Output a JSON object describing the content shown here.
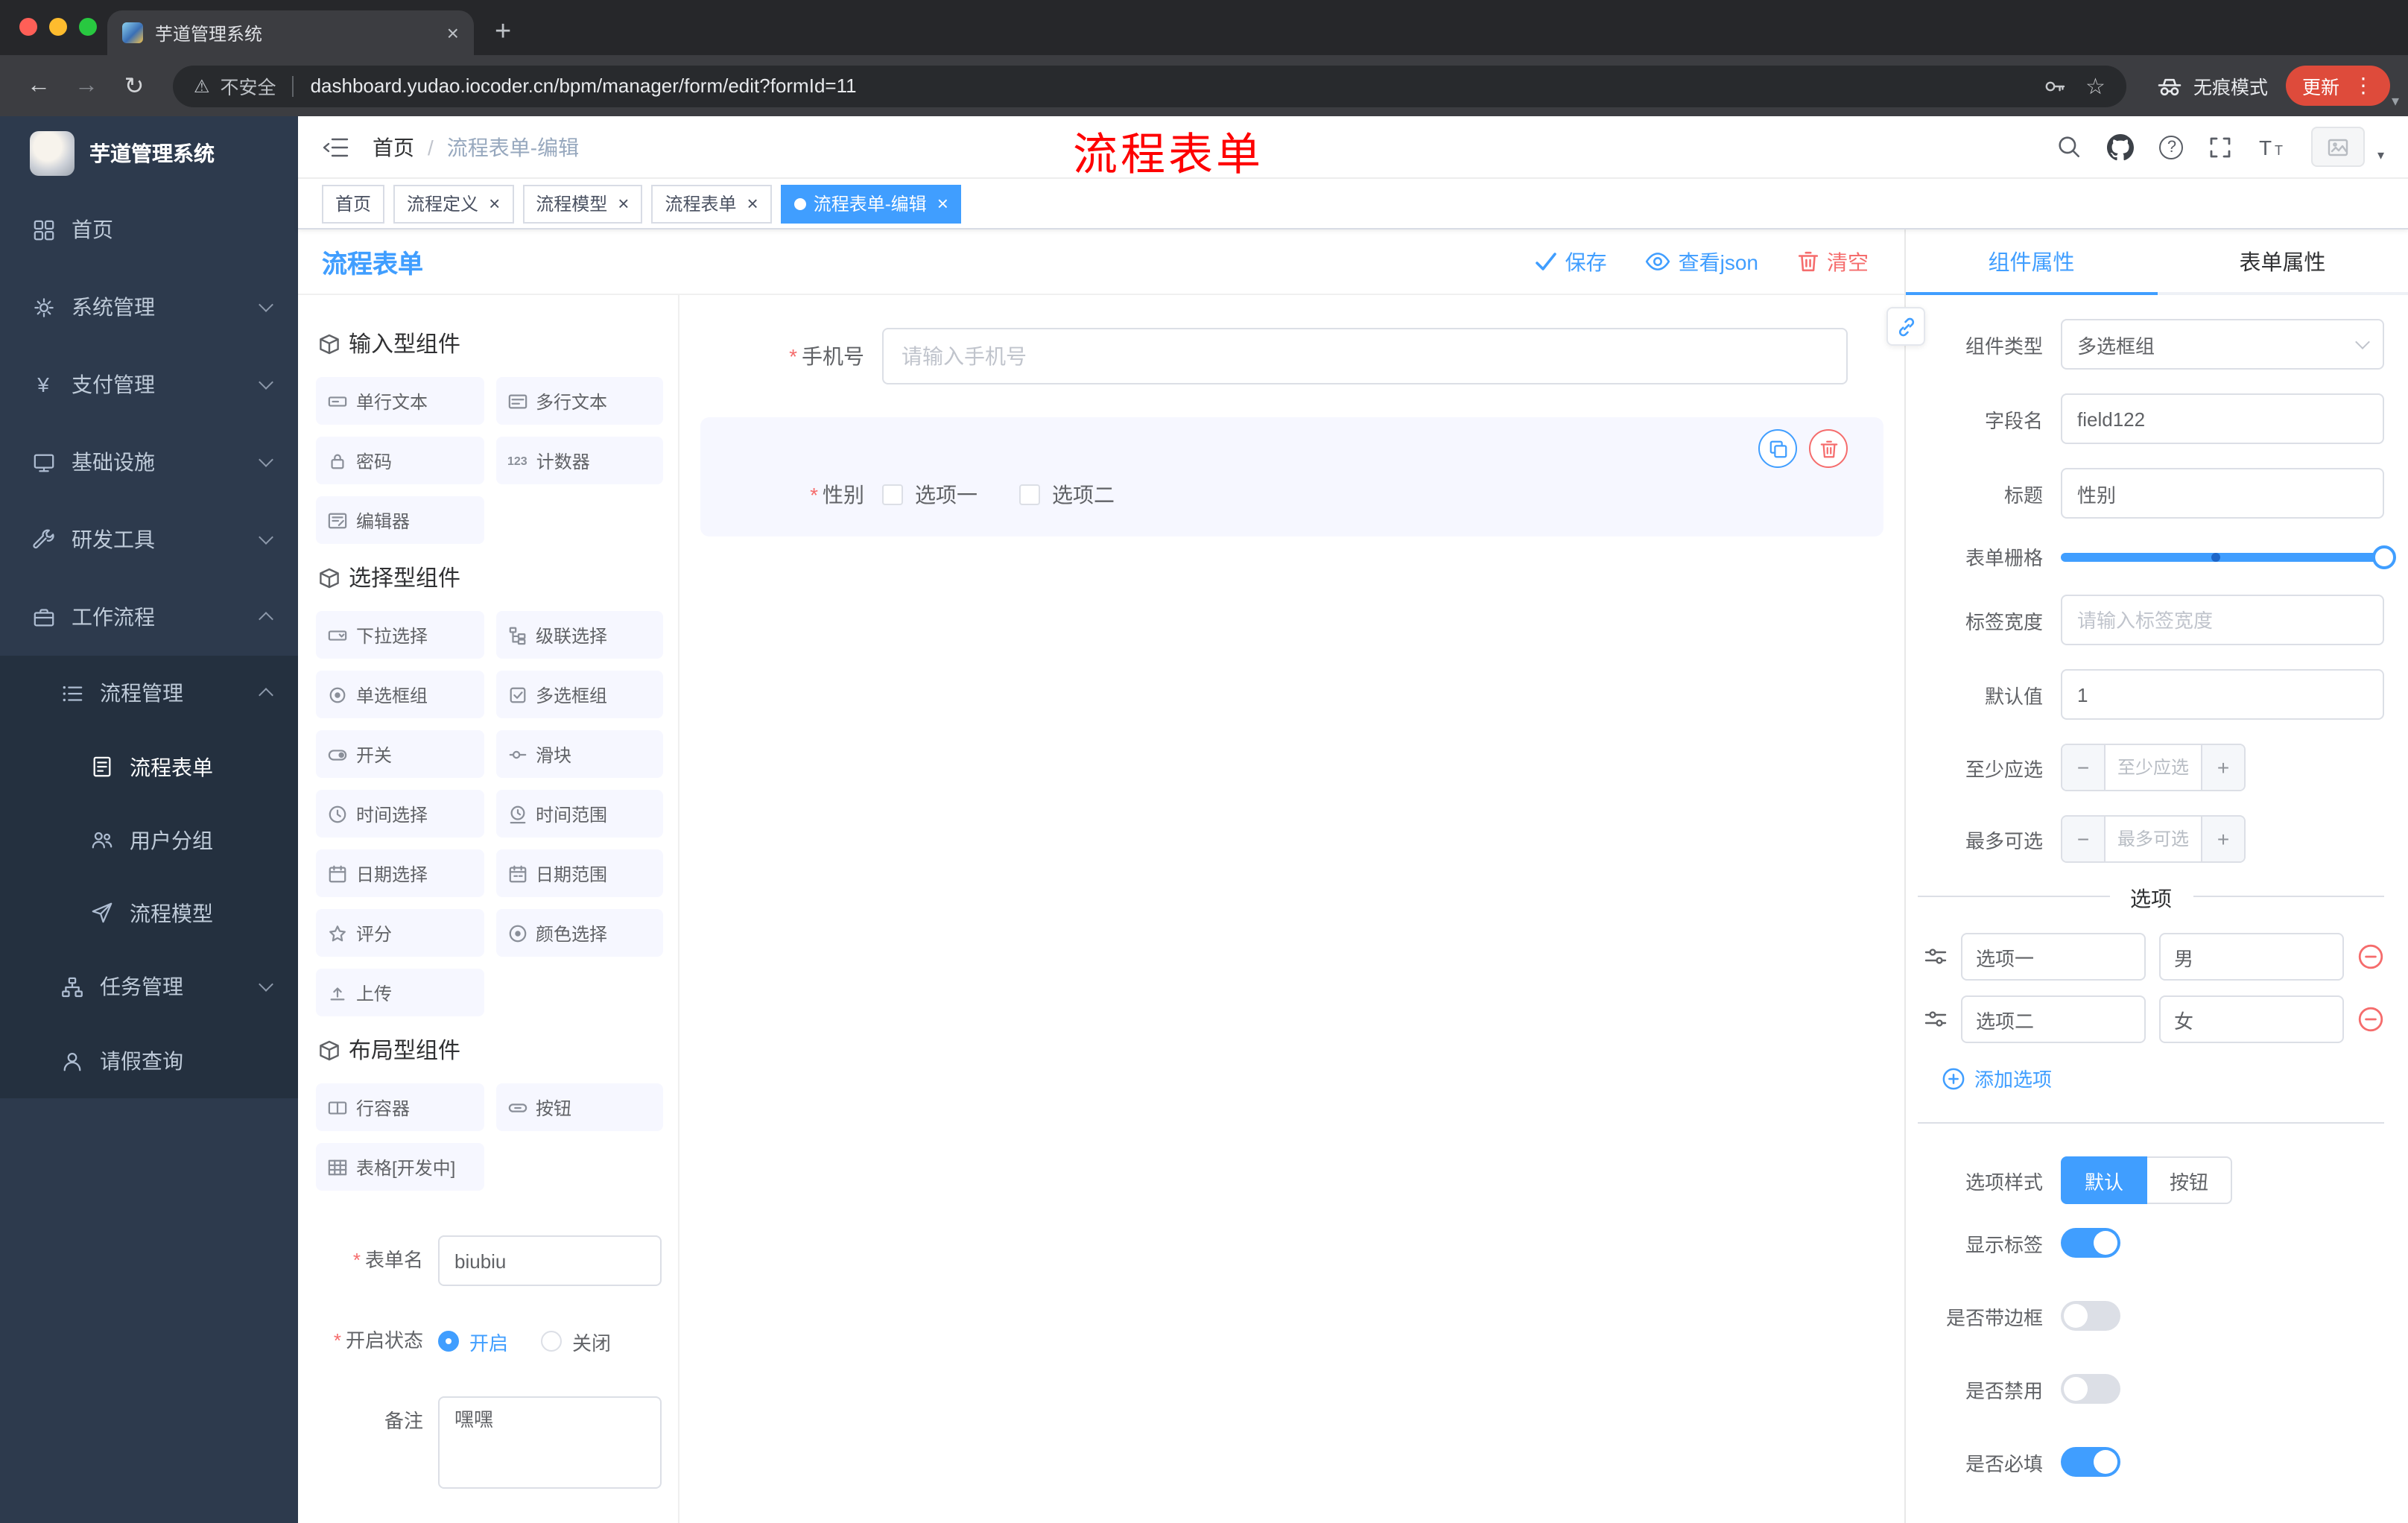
{
  "colors": {
    "accent": "#409eff",
    "danger": "#f56c6c",
    "sidebar_bg": "#2d3a4d",
    "annotation_red": "#fe0000",
    "update_pill": "#de4b3b",
    "palette_item_bg": "#f6f7ff"
  },
  "glyphs": {
    "close": "×",
    "plus": "+",
    "back": "←",
    "forward": "→",
    "reload": "↻",
    "star": "☆",
    "kebab": "⋮",
    "caret_down": "▾",
    "asterisk": "*",
    "minus": "−",
    "question": "?",
    "warning": "⚠",
    "yen": "¥",
    "counter": "123"
  },
  "browser": {
    "tab_title": "芋道管理系统",
    "security_label": "不安全",
    "url": "dashboard.yudao.iocoder.cn/bpm/manager/form/edit?formId=11",
    "incognito_label": "无痕模式",
    "update_label": "更新"
  },
  "sidebar": {
    "title": "芋道管理系统",
    "home": "首页",
    "system": "系统管理",
    "payment": "支付管理",
    "infra": "基础设施",
    "devtools": "研发工具",
    "workflow": "工作流程",
    "process_mgmt": "流程管理",
    "process_form": "流程表单",
    "user_group": "用户分组",
    "process_model": "流程模型",
    "task_mgmt": "任务管理",
    "leave_query": "请假查询"
  },
  "header": {
    "breadcrumb_home": "首页",
    "breadcrumb_sep": "/",
    "breadcrumb_current": "流程表单-编辑",
    "annotation": "流程表单"
  },
  "tags": {
    "items": [
      "首页",
      "流程定义",
      "流程模型",
      "流程表单",
      "流程表单-编辑"
    ]
  },
  "designer": {
    "title": "流程表单",
    "save": "保存",
    "view_json": "查看json",
    "clear": "清空"
  },
  "palette": {
    "input_section": "输入型组件",
    "select_section": "选择型组件",
    "layout_section": "布局型组件",
    "input_items": [
      "单行文本",
      "多行文本",
      "密码",
      "计数器",
      "编辑器"
    ],
    "select_items": [
      "下拉选择",
      "级联选择",
      "单选框组",
      "多选框组",
      "开关",
      "滑块",
      "时间选择",
      "时间范围",
      "日期选择",
      "日期范围",
      "评分",
      "颜色选择",
      "上传"
    ],
    "layout_items": [
      "行容器",
      "按钮",
      "表格[开发中]"
    ]
  },
  "meta": {
    "form_name_label": "表单名",
    "form_name_value": "biubiu",
    "status_label": "开启状态",
    "status_on": "开启",
    "status_off": "关闭",
    "remark_label": "备注",
    "remark_value": "嘿嘿"
  },
  "canvas": {
    "phone_label": "手机号",
    "phone_placeholder": "请输入手机号",
    "gender_label": "性别",
    "gender_opt1": "选项一",
    "gender_opt2": "选项二"
  },
  "props": {
    "tab_component": "组件属性",
    "tab_form": "表单属性",
    "type_label": "组件类型",
    "type_value": "多选框组",
    "field_label": "字段名",
    "field_value": "field122",
    "title_label": "标题",
    "title_value": "性别",
    "grid_label": "表单栅格",
    "width_label": "标签宽度",
    "width_placeholder": "请输入标签宽度",
    "default_label": "默认值",
    "default_value": "1",
    "min_label": "至少应选",
    "min_placeholder": "至少应选",
    "max_label": "最多可选",
    "max_placeholder": "最多可选",
    "options_title": "选项",
    "opt1_label": "选项一",
    "opt1_value": "男",
    "opt2_label": "选项二",
    "opt2_value": "女",
    "add_option": "添加选项",
    "style_label": "选项样式",
    "style_default": "默认",
    "style_button": "按钮",
    "show_label": "显示标签",
    "border_label": "是否带边框",
    "disabled_label": "是否禁用",
    "required_label": "是否必填"
  }
}
